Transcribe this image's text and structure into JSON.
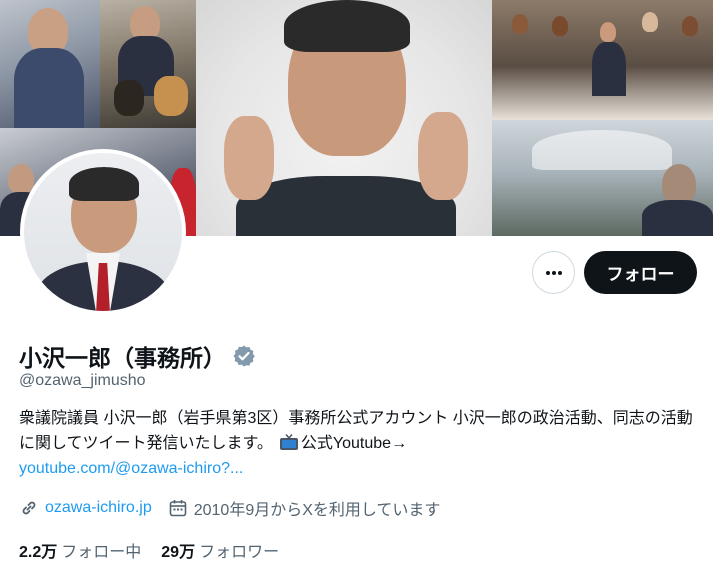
{
  "banner": {
    "icon": "collage-banner"
  },
  "profile": {
    "display_name": "小沢一郎（事務所）",
    "verified_icon": "verified-badge-icon",
    "handle": "@ozawa_jimusho",
    "bio_text": "衆議院議員 小沢一郎（岩手県第3区）事務所公式アカウント 小沢一郎の政治活動、同志の活動に関してツイート発信いたします。",
    "bio_emoji": "tv-icon",
    "bio_suffix": "公式Youtube→",
    "bio_link": "youtube.com/@ozawa-ichiro?...",
    "website": "ozawa-ichiro.jp",
    "joined": "2010年9月からXを利用しています"
  },
  "actions": {
    "more_icon": "ellipsis-icon",
    "follow_label": "フォロー"
  },
  "stats": {
    "following_count": "2.2万",
    "following_label": "フォロー中",
    "followers_count": "29万",
    "followers_label": "フォロワー"
  },
  "colors": {
    "accent": "#1d9bf0",
    "text": "#0f1419",
    "muted": "#536471",
    "verified": "#829aab"
  }
}
